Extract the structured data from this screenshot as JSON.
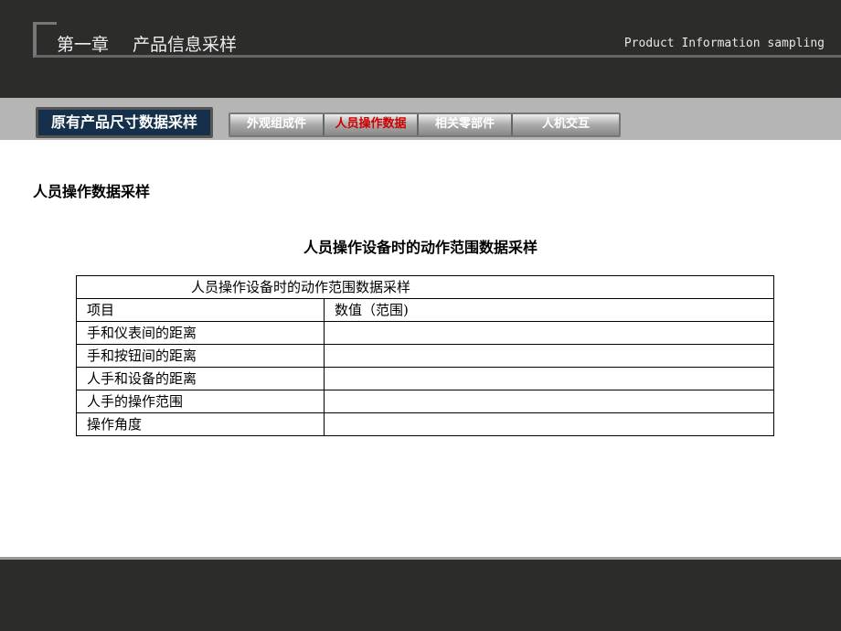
{
  "header": {
    "chapter": "第一章",
    "title": "产品信息采样",
    "english": "Product Information sampling"
  },
  "nav": {
    "main_tab": "原有产品尺寸数据采样",
    "tabs": [
      {
        "label": "外观组成件",
        "active": false
      },
      {
        "label": "人员操作数据",
        "active": true
      },
      {
        "label": "相关零部件",
        "active": false
      },
      {
        "label": "人机交互",
        "active": false
      }
    ],
    "active_color": "#cc0000"
  },
  "section_title": "人员操作数据采样",
  "caption": "人员操作设备时的动作范围数据采样",
  "table": {
    "title": "人员操作设备时的动作范围数据采样",
    "headers": [
      "项目",
      "数值（范围)"
    ],
    "rows": [
      [
        "手和仪表间的距离",
        ""
      ],
      [
        "手和按钮间的距离",
        ""
      ],
      [
        "人手和设备的距离",
        ""
      ],
      [
        "人手的操作范围",
        ""
      ],
      [
        "操作角度",
        ""
      ]
    ]
  }
}
